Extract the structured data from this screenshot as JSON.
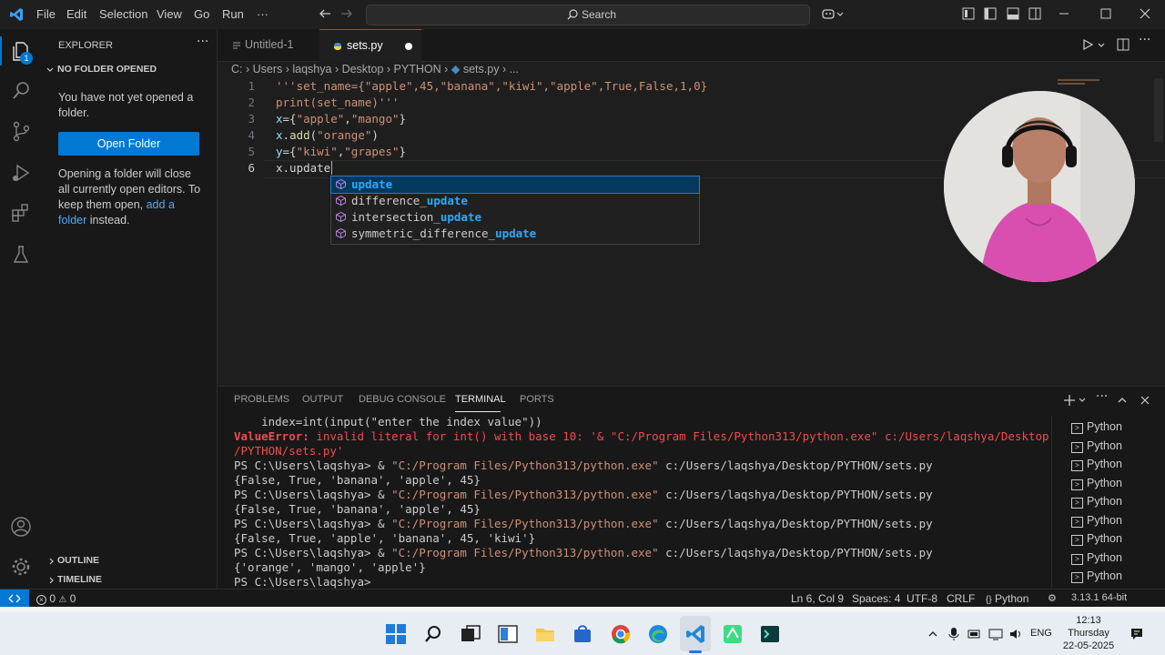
{
  "menu": [
    "File",
    "Edit",
    "Selection",
    "View",
    "Go",
    "Run",
    "···"
  ],
  "search": {
    "placeholder": "Search"
  },
  "sidebar": {
    "title": "EXPLORER",
    "section": "NO FOLDER OPENED",
    "message": "You have not yet opened a folder.",
    "open_button": "Open Folder",
    "info_1": "Opening a folder will close all currently open editors. To keep them open,",
    "info_link": "add a folder",
    "info_2": "instead.",
    "outline": "OUTLINE",
    "timeline": "TIMELINE",
    "explorer_badge": "1"
  },
  "tabs": [
    {
      "label": "Untitled-1",
      "active": false
    },
    {
      "label": "sets.py",
      "active": true
    }
  ],
  "breadcrumb": [
    "C:",
    "Users",
    "laqshya",
    "Desktop",
    "PYTHON",
    "sets.py",
    "..."
  ],
  "code": {
    "line_numbers": [
      "1",
      "2",
      "3",
      "4",
      "5",
      "6"
    ],
    "line1": "'''set_name={\"apple\",45,\"banana\",\"kiwi\",\"apple\",True,False,1,0}",
    "line2": "print(set_name)'''",
    "line3": "x={\"apple\",\"mango\"}",
    "line4": "x.add(\"orange\")",
    "line5": "y={\"kiwi\",\"grapes\"}",
    "line6": "x.update"
  },
  "suggest": [
    {
      "prefix": "",
      "match": "update"
    },
    {
      "prefix": "difference_",
      "match": "update"
    },
    {
      "prefix": "intersection_",
      "match": "update"
    },
    {
      "prefix": "symmetric_difference_",
      "match": "update"
    }
  ],
  "panel": {
    "tabs": [
      "PROBLEMS",
      "OUTPUT",
      "DEBUG CONSOLE",
      "TERMINAL",
      "PORTS"
    ],
    "active_tab": "TERMINAL",
    "terminal_list_label": "Python",
    "terminal": {
      "l1": "    index=int(input(\"enter the index value\"))",
      "l2a": "ValueError:",
      "l2b": " invalid literal for int() with base 10: '& \"C:/Program Files/Python313/python.exe\" c:/Users/laqshya/Desktop",
      "l3": "/PYTHON/sets.py'",
      "prompt": "PS C:\\Users\\laqshya> & ",
      "exe": "\"C:/Program Files/Python313/python.exe\"",
      "script": " c:/Users/laqshya/Desktop/PYTHON/sets.py",
      "out1": "{False, True, 'banana', 'apple', 45}",
      "out2": "{False, True, 'banana', 'apple', 45}",
      "out3": "{False, True, 'apple', 'banana', 45, 'kiwi'}",
      "out4": "{'orange', 'mango', 'apple'}",
      "last_prompt": "PS C:\\Users\\laqshya>"
    }
  },
  "status": {
    "errors": "0",
    "warnings": "0",
    "position": "Ln 6, Col 9",
    "spaces": "Spaces: 4",
    "encoding": "UTF-8",
    "eol": "CRLF",
    "language": "Python",
    "interpreter": "3.13.1 64-bit"
  },
  "taskbar": {
    "lang": "ENG",
    "time": "12:13",
    "day": "Thursday",
    "date": "22-05-2025"
  },
  "colors": {
    "accent": "#0078d4",
    "string": "#ce9178",
    "error": "#f14c4c",
    "match": "#2aaaff"
  }
}
